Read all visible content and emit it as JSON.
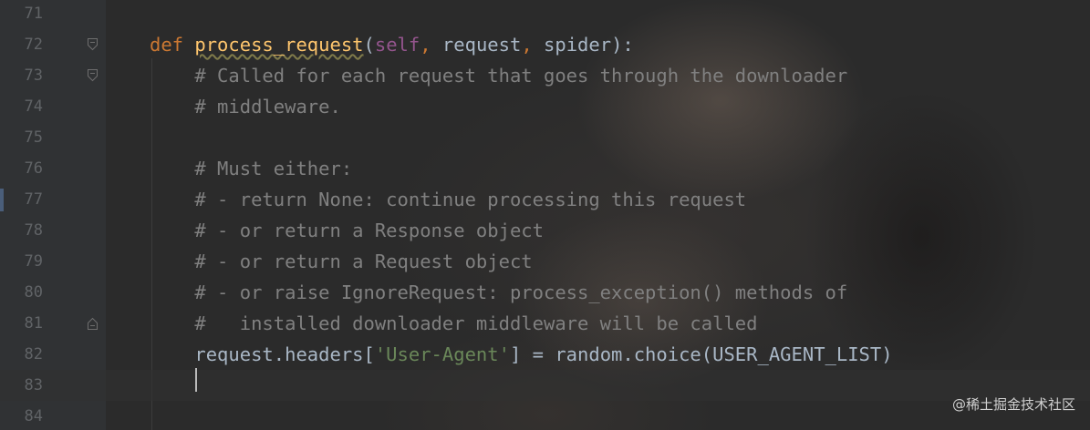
{
  "editor": {
    "lines": [
      {
        "number": "71",
        "code": []
      },
      {
        "number": "72",
        "code": [
          {
            "t": "def ",
            "c": "kw"
          },
          {
            "t": "process_request",
            "c": "fn"
          },
          {
            "t": "(",
            "c": ""
          },
          {
            "t": "self",
            "c": "slf"
          },
          {
            "t": ", ",
            "c": "kw"
          },
          {
            "t": "request",
            "c": ""
          },
          {
            "t": ", ",
            "c": "kw"
          },
          {
            "t": "spider",
            "c": ""
          },
          {
            "t": "):",
            "c": ""
          }
        ]
      },
      {
        "number": "73",
        "code": [
          {
            "t": "    # Called for each request that goes through the downloader",
            "c": "cm"
          }
        ]
      },
      {
        "number": "74",
        "code": [
          {
            "t": "    # middleware.",
            "c": "cm"
          }
        ]
      },
      {
        "number": "75",
        "code": []
      },
      {
        "number": "76",
        "code": [
          {
            "t": "    # Must either:",
            "c": "cm"
          }
        ]
      },
      {
        "number": "77",
        "code": [
          {
            "t": "    # - return None: continue processing this request",
            "c": "cm"
          }
        ]
      },
      {
        "number": "78",
        "code": [
          {
            "t": "    # - or return a Response object",
            "c": "cm"
          }
        ]
      },
      {
        "number": "79",
        "code": [
          {
            "t": "    # - or return a Request object",
            "c": "cm"
          }
        ]
      },
      {
        "number": "80",
        "code": [
          {
            "t": "    # - or raise IgnoreRequest: process_exception() methods of",
            "c": "cm"
          }
        ]
      },
      {
        "number": "81",
        "code": [
          {
            "t": "    #   installed downloader middleware will be called",
            "c": "cm"
          }
        ]
      },
      {
        "number": "82",
        "code": [
          {
            "t": "    request.headers[",
            "c": ""
          },
          {
            "t": "'User-Agent'",
            "c": "str"
          },
          {
            "t": "] = random.choice(USER_AGENT_LIST)",
            "c": ""
          }
        ]
      },
      {
        "number": "83",
        "code": []
      },
      {
        "number": "84",
        "code": []
      }
    ],
    "fold_markers": {
      "72": "fold-open",
      "73": "fold-open",
      "81": "fold-close"
    },
    "current_line": "83"
  },
  "watermark": "@稀土掘金技术社区",
  "colors": {
    "background": "#2b2b2b",
    "gutter": "#313335",
    "line_number": "#606366",
    "keyword": "#cc7832",
    "function": "#ffc66d",
    "self": "#94558d",
    "comment": "#808080",
    "string": "#6a8759",
    "default": "#a9b7c6"
  }
}
